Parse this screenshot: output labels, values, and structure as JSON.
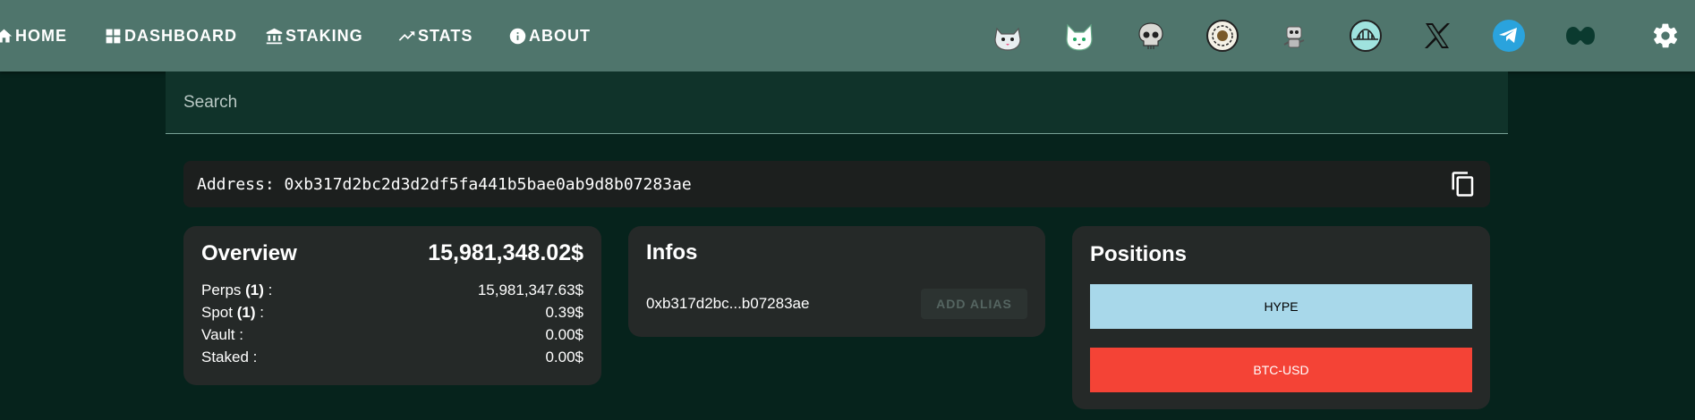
{
  "nav": {
    "home": "HOME",
    "dashboard": "DASHBOARD",
    "staking": "STAKING",
    "stats": "STATS",
    "about": "ABOUT"
  },
  "socials": [
    "cat-mascot-icon",
    "fox-mascot-icon",
    "skull-icon",
    "lion-emblem-icon",
    "robot-mascot-icon",
    "bridge-logo-icon",
    "x-logo-icon",
    "telegram-icon",
    "hyperliquid-logo-icon"
  ],
  "search": {
    "placeholder": "Search"
  },
  "address": {
    "label": "Address: 0xb317d2bc2d3d2df5fa441b5bae0ab9d8b07283ae"
  },
  "overview": {
    "title": "Overview",
    "total": "15,981,348.02$",
    "rows": [
      {
        "label": "Perps ",
        "count": "(1)",
        "suffix": " :",
        "value": "15,981,347.63$"
      },
      {
        "label": "Spot ",
        "count": "(1)",
        "suffix": " :",
        "value": "0.39$"
      },
      {
        "label": "Vault :",
        "count": "",
        "suffix": "",
        "value": "0.00$"
      },
      {
        "label": "Staked :",
        "count": "",
        "suffix": "",
        "value": "0.00$"
      }
    ]
  },
  "infos": {
    "title": "Infos",
    "short_address": "0xb317d2bc...b07283ae",
    "alias_button": "ADD ALIAS"
  },
  "positions": {
    "title": "Positions",
    "items": [
      "HYPE",
      "BTC-USD"
    ]
  },
  "colors": {
    "topbar": "#4f756c",
    "background": "#06231c",
    "card": "#252928",
    "hype": "#a8d8ea",
    "btc": "#f44336"
  }
}
